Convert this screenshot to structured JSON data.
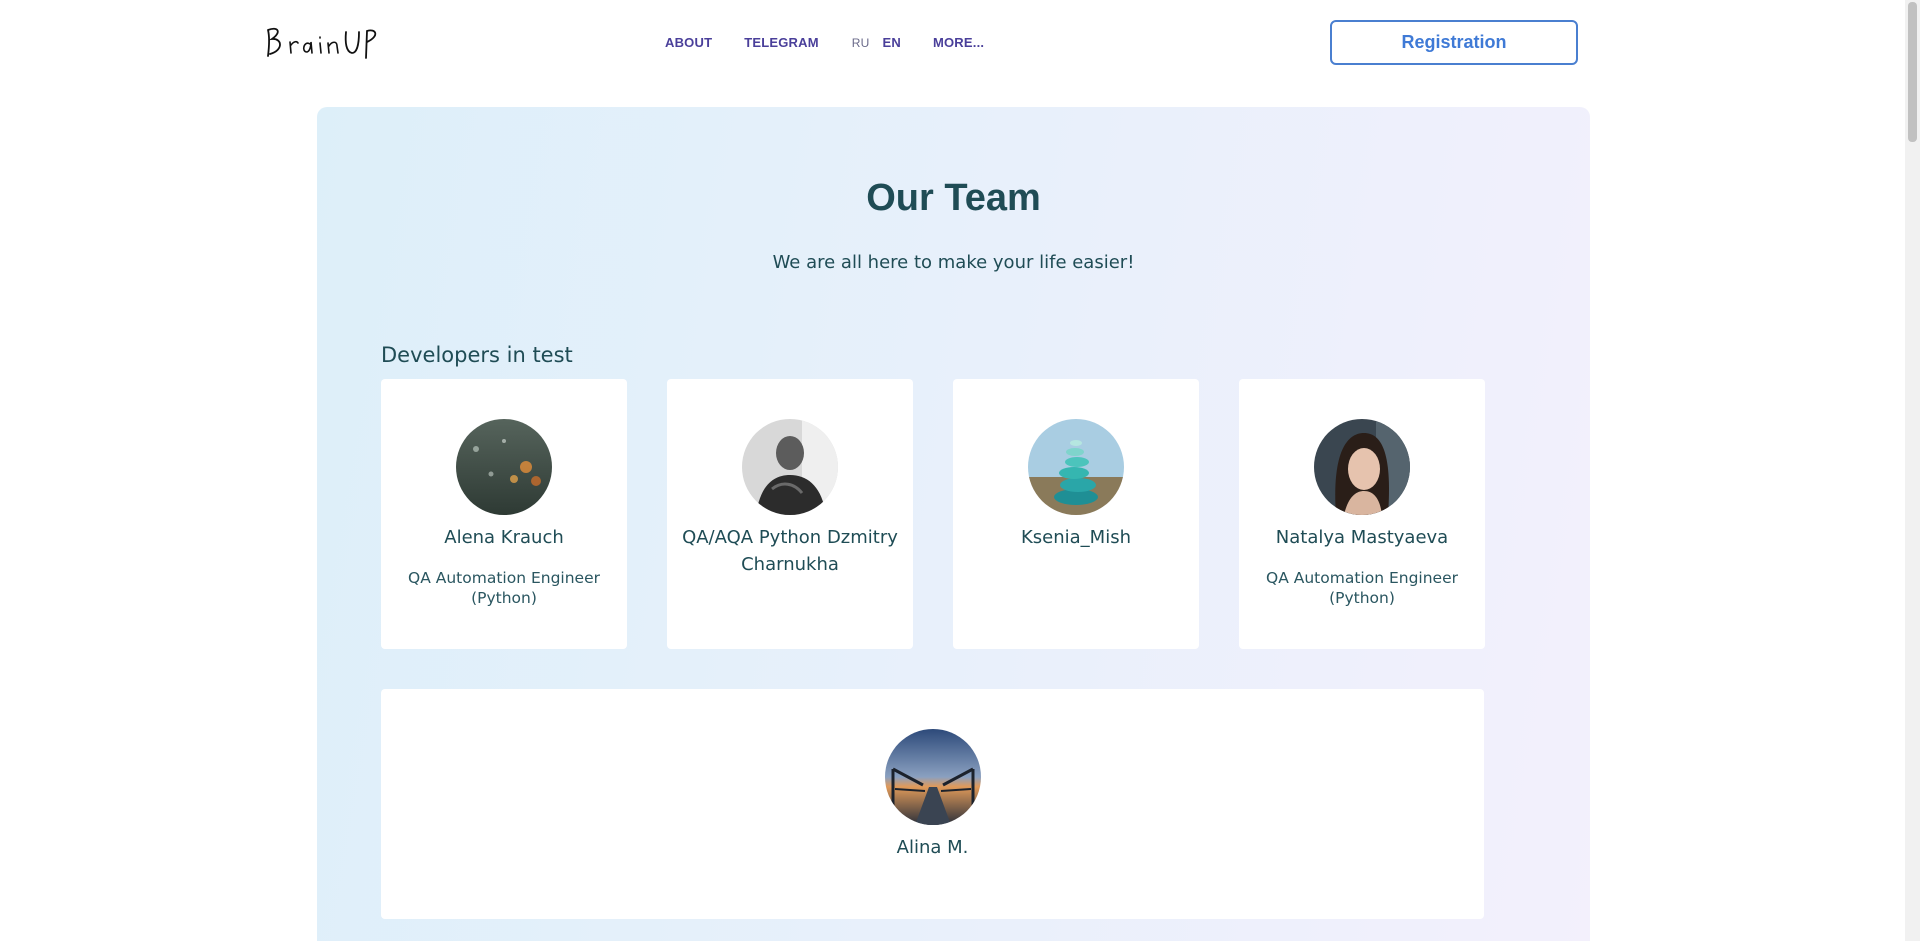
{
  "header": {
    "logo_text": "BrainUP",
    "nav": {
      "about": "ABOUT",
      "telegram": "TELEGRAM",
      "lang_ru": "RU",
      "lang_en": "EN",
      "more": "MORE..."
    },
    "registration_label": "Registration"
  },
  "section": {
    "title": "Our Team",
    "subtitle": "We are all here to make your life easier!",
    "group_title": "Developers in test",
    "members": [
      {
        "name": "Alena Krauch",
        "role": "QA Automation Engineer (Python)",
        "avatar": "rainy-window-photo"
      },
      {
        "name": "QA/AQA Python Dzmitry Charnukha",
        "role": "",
        "avatar": "man-portrait-photo"
      },
      {
        "name": "Ksenia_Mish",
        "role": "",
        "avatar": "stacked-stones-photo"
      },
      {
        "name": "Natalya Mastyaeva",
        "role": "QA Automation Engineer (Python)",
        "avatar": "woman-portrait-photo"
      },
      {
        "name": "Alina M.",
        "role": "",
        "avatar": "sunset-pier-photo"
      }
    ]
  },
  "colors": {
    "heading": "#1f4c55",
    "nav": "#4a3f9a",
    "button_border": "#4a7fd0",
    "gradient_start": "#ddeff9",
    "gradient_end": "#f3f0fc"
  }
}
